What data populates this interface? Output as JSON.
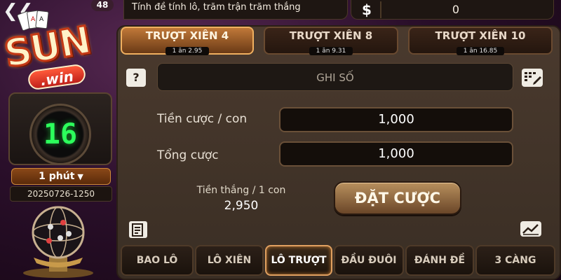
{
  "header": {
    "badge_count": "48",
    "slogan": "Tính đề tính lô, trăm trận trăm thắng",
    "currency_symbol": "$",
    "balance": "0"
  },
  "logo": {
    "brand_main": "SUN",
    "brand_sub": ".win"
  },
  "side": {
    "countdown": "16",
    "period_label": "1 phút",
    "round_id": "20250726-1250"
  },
  "bet_type_tabs": [
    {
      "label": "TRƯỢT XIÊN 4",
      "odds": "1 ăn 2.95",
      "active": true
    },
    {
      "label": "TRƯỢT XIÊN 8",
      "odds": "1 ăn 9.31",
      "active": false
    },
    {
      "label": "TRƯỢT XIÊN 10",
      "odds": "1 ăn 16.85",
      "active": false
    }
  ],
  "form": {
    "help_icon": "?",
    "note_placeholder": "GHI SỐ",
    "stake_label": "Tiền cược / con",
    "stake_value": "1,000",
    "total_label": "Tổng cược",
    "total_value": "1,000",
    "win_label": "Tiền thắng / 1 con",
    "win_value": "2,950",
    "bet_button": "ĐẶT CƯỢC"
  },
  "game_tabs": [
    {
      "label": "BAO LÔ",
      "active": false
    },
    {
      "label": "LÔ XIÊN",
      "active": false
    },
    {
      "label": "LÔ TRƯỢT",
      "active": true
    },
    {
      "label": "ĐẦU ĐUÔI",
      "active": false
    },
    {
      "label": "ĐÁNH ĐỀ",
      "active": false
    },
    {
      "label": "3 CÀNG",
      "active": false
    }
  ],
  "colors": {
    "accent": "#f0b060",
    "timer": "#2cff5c",
    "panel": "#4a3a2e"
  },
  "icons": {
    "back": "back-arrow-icon",
    "dollar": "dollar-icon",
    "help": "help-icon",
    "keypad": "keypad-edit-icon",
    "history": "history-note-icon",
    "chart": "trend-chart-icon",
    "period_dropdown": "chevron-down-icon"
  }
}
